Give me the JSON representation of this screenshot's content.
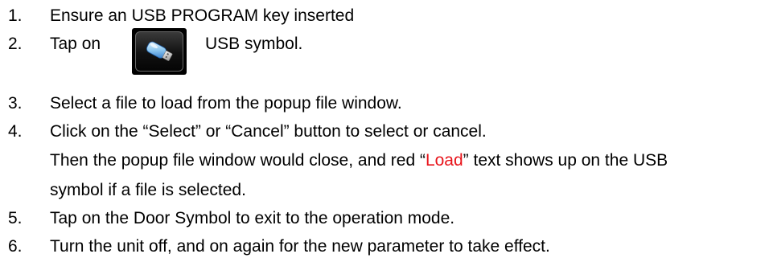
{
  "steps": [
    {
      "number": "1.",
      "text": "Ensure an USB PROGRAM key inserted"
    },
    {
      "number": "2.",
      "text_before_icon": "Tap on",
      "text_after_icon": "USB symbol.",
      "icon": "usb-drive-icon"
    },
    {
      "number": "3.",
      "text": "Select a file to load from the popup file window."
    },
    {
      "number": "4.",
      "text": "Click on the “Select” or “Cancel” button to select or cancel.",
      "continuation_1_before": "Then the popup file window would close, and red “",
      "continuation_1_red": "Load",
      "continuation_1_after": "” text shows up on the USB",
      "continuation_2": "symbol if a file is selected."
    },
    {
      "number": "5.",
      "text": "Tap on the Door Symbol to exit to the operation mode."
    },
    {
      "number": "6.",
      "text": "Turn the unit off, and on again for the new parameter to take effect."
    }
  ],
  "colors": {
    "text": "#000000",
    "highlight_red": "#e8141b",
    "icon_background": "#000000"
  }
}
